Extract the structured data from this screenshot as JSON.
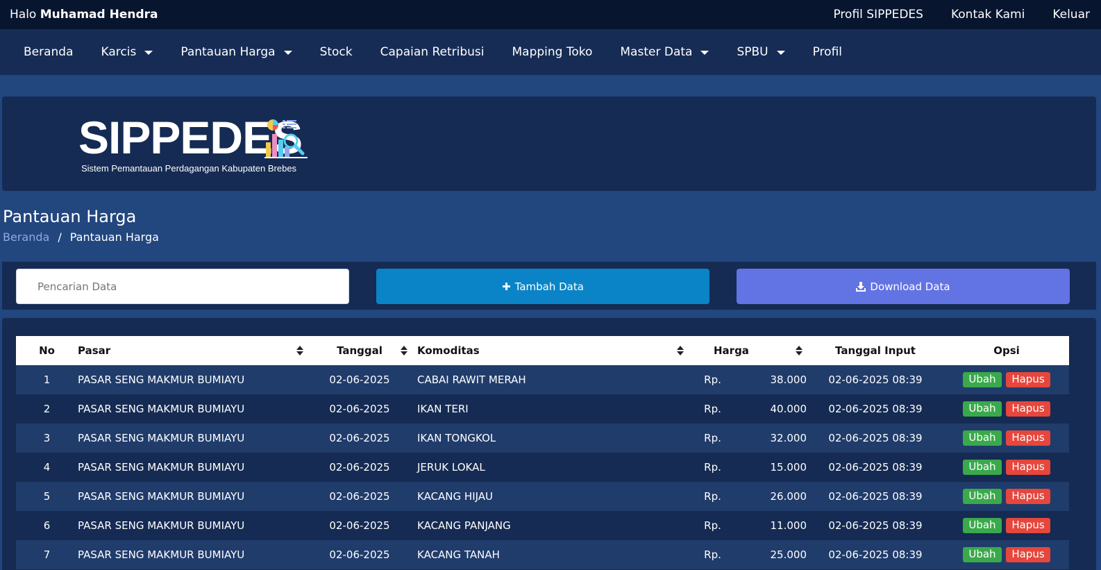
{
  "topbar": {
    "greeting_prefix": "Halo",
    "user_name": "Muhamad Hendra",
    "links": [
      "Profil SIPPEDES",
      "Kontak Kami",
      "Keluar"
    ]
  },
  "nav": [
    {
      "label": "Beranda",
      "dropdown": false
    },
    {
      "label": "Karcis",
      "dropdown": true
    },
    {
      "label": "Pantauan Harga",
      "dropdown": true
    },
    {
      "label": "Stock",
      "dropdown": false
    },
    {
      "label": "Capaian Retribusi",
      "dropdown": false
    },
    {
      "label": "Mapping Toko",
      "dropdown": false
    },
    {
      "label": "Master Data",
      "dropdown": true
    },
    {
      "label": "SPBU",
      "dropdown": true
    },
    {
      "label": "Profil",
      "dropdown": false
    }
  ],
  "logo": {
    "title": "SIPPEDES",
    "subtitle": "Sistem Pemantauan Perdagangan Kabupaten Brebes"
  },
  "page": {
    "title": "Pantauan Harga",
    "breadcrumb_home": "Beranda",
    "breadcrumb_sep": "/",
    "breadcrumb_current": "Pantauan Harga"
  },
  "toolbar": {
    "search_placeholder": "Pencarian Data",
    "add_label": "Tambah Data",
    "download_label": "Download Data"
  },
  "table": {
    "headers": {
      "no": "No",
      "pasar": "Pasar",
      "tanggal": "Tanggal",
      "komoditas": "Komoditas",
      "harga": "Harga",
      "tanggal_input": "Tanggal Input",
      "opsi": "Opsi"
    },
    "edit_label": "Ubah",
    "delete_label": "Hapus",
    "rows": [
      {
        "no": "1",
        "pasar": "PASAR SENG MAKMUR BUMIAYU",
        "tanggal": "02-06-2025",
        "komoditas": "CABAI RAWIT MERAH",
        "currency": "Rp.",
        "harga": "38.000",
        "tanggal_input": "02-06-2025 08:39"
      },
      {
        "no": "2",
        "pasar": "PASAR SENG MAKMUR BUMIAYU",
        "tanggal": "02-06-2025",
        "komoditas": "IKAN TERI",
        "currency": "Rp.",
        "harga": "40.000",
        "tanggal_input": "02-06-2025 08:39"
      },
      {
        "no": "3",
        "pasar": "PASAR SENG MAKMUR BUMIAYU",
        "tanggal": "02-06-2025",
        "komoditas": "IKAN TONGKOL",
        "currency": "Rp.",
        "harga": "32.000",
        "tanggal_input": "02-06-2025 08:39"
      },
      {
        "no": "4",
        "pasar": "PASAR SENG MAKMUR BUMIAYU",
        "tanggal": "02-06-2025",
        "komoditas": "JERUK LOKAL",
        "currency": "Rp.",
        "harga": "15.000",
        "tanggal_input": "02-06-2025 08:39"
      },
      {
        "no": "5",
        "pasar": "PASAR SENG MAKMUR BUMIAYU",
        "tanggal": "02-06-2025",
        "komoditas": "KACANG HIJAU",
        "currency": "Rp.",
        "harga": "26.000",
        "tanggal_input": "02-06-2025 08:39"
      },
      {
        "no": "6",
        "pasar": "PASAR SENG MAKMUR BUMIAYU",
        "tanggal": "02-06-2025",
        "komoditas": "KACANG PANJANG",
        "currency": "Rp.",
        "harga": "11.000",
        "tanggal_input": "02-06-2025 08:39"
      },
      {
        "no": "7",
        "pasar": "PASAR SENG MAKMUR BUMIAYU",
        "tanggal": "02-06-2025",
        "komoditas": "KACANG TANAH",
        "currency": "Rp.",
        "harga": "25.000",
        "tanggal_input": "02-06-2025 08:39"
      }
    ]
  },
  "colors": {
    "page_bg": "#22467e",
    "topbar_bg": "#07152f",
    "nav_bg": "#162c55",
    "add_button": "#0a84c6",
    "download_button": "#6273e4",
    "edit_badge": "#3aa94b",
    "delete_badge": "#e6463c"
  }
}
